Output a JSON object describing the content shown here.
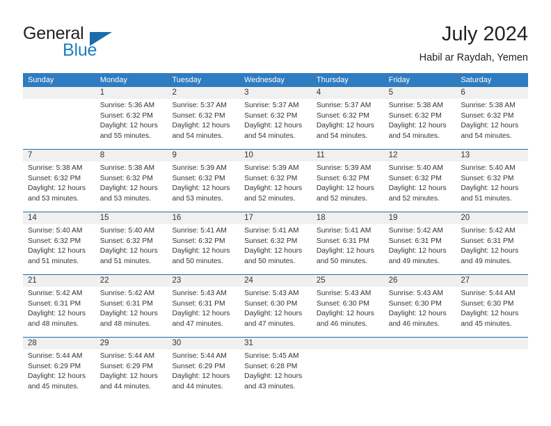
{
  "brand": {
    "word1": "General",
    "word2": "Blue",
    "logo_icon": "blue-triangle-icon",
    "accent_color": "#1f7dc0"
  },
  "header": {
    "title": "July 2024",
    "subtitle": "Habil ar Raydah, Yemen"
  },
  "calendar": {
    "header_bg": "#2f7cc0",
    "band_bg": "#f0f0f0",
    "rule_color": "#1b6cab",
    "weekdays": [
      "Sunday",
      "Monday",
      "Tuesday",
      "Wednesday",
      "Thursday",
      "Friday",
      "Saturday"
    ],
    "weeks": [
      [
        {
          "day": "",
          "sunrise": "",
          "sunset": "",
          "daylight1": "",
          "daylight2": "",
          "empty": true
        },
        {
          "day": "1",
          "sunrise": "Sunrise: 5:36 AM",
          "sunset": "Sunset: 6:32 PM",
          "daylight1": "Daylight: 12 hours",
          "daylight2": "and 55 minutes."
        },
        {
          "day": "2",
          "sunrise": "Sunrise: 5:37 AM",
          "sunset": "Sunset: 6:32 PM",
          "daylight1": "Daylight: 12 hours",
          "daylight2": "and 54 minutes."
        },
        {
          "day": "3",
          "sunrise": "Sunrise: 5:37 AM",
          "sunset": "Sunset: 6:32 PM",
          "daylight1": "Daylight: 12 hours",
          "daylight2": "and 54 minutes."
        },
        {
          "day": "4",
          "sunrise": "Sunrise: 5:37 AM",
          "sunset": "Sunset: 6:32 PM",
          "daylight1": "Daylight: 12 hours",
          "daylight2": "and 54 minutes."
        },
        {
          "day": "5",
          "sunrise": "Sunrise: 5:38 AM",
          "sunset": "Sunset: 6:32 PM",
          "daylight1": "Daylight: 12 hours",
          "daylight2": "and 54 minutes."
        },
        {
          "day": "6",
          "sunrise": "Sunrise: 5:38 AM",
          "sunset": "Sunset: 6:32 PM",
          "daylight1": "Daylight: 12 hours",
          "daylight2": "and 54 minutes."
        }
      ],
      [
        {
          "day": "7",
          "sunrise": "Sunrise: 5:38 AM",
          "sunset": "Sunset: 6:32 PM",
          "daylight1": "Daylight: 12 hours",
          "daylight2": "and 53 minutes."
        },
        {
          "day": "8",
          "sunrise": "Sunrise: 5:38 AM",
          "sunset": "Sunset: 6:32 PM",
          "daylight1": "Daylight: 12 hours",
          "daylight2": "and 53 minutes."
        },
        {
          "day": "9",
          "sunrise": "Sunrise: 5:39 AM",
          "sunset": "Sunset: 6:32 PM",
          "daylight1": "Daylight: 12 hours",
          "daylight2": "and 53 minutes."
        },
        {
          "day": "10",
          "sunrise": "Sunrise: 5:39 AM",
          "sunset": "Sunset: 6:32 PM",
          "daylight1": "Daylight: 12 hours",
          "daylight2": "and 52 minutes."
        },
        {
          "day": "11",
          "sunrise": "Sunrise: 5:39 AM",
          "sunset": "Sunset: 6:32 PM",
          "daylight1": "Daylight: 12 hours",
          "daylight2": "and 52 minutes."
        },
        {
          "day": "12",
          "sunrise": "Sunrise: 5:40 AM",
          "sunset": "Sunset: 6:32 PM",
          "daylight1": "Daylight: 12 hours",
          "daylight2": "and 52 minutes."
        },
        {
          "day": "13",
          "sunrise": "Sunrise: 5:40 AM",
          "sunset": "Sunset: 6:32 PM",
          "daylight1": "Daylight: 12 hours",
          "daylight2": "and 51 minutes."
        }
      ],
      [
        {
          "day": "14",
          "sunrise": "Sunrise: 5:40 AM",
          "sunset": "Sunset: 6:32 PM",
          "daylight1": "Daylight: 12 hours",
          "daylight2": "and 51 minutes."
        },
        {
          "day": "15",
          "sunrise": "Sunrise: 5:40 AM",
          "sunset": "Sunset: 6:32 PM",
          "daylight1": "Daylight: 12 hours",
          "daylight2": "and 51 minutes."
        },
        {
          "day": "16",
          "sunrise": "Sunrise: 5:41 AM",
          "sunset": "Sunset: 6:32 PM",
          "daylight1": "Daylight: 12 hours",
          "daylight2": "and 50 minutes."
        },
        {
          "day": "17",
          "sunrise": "Sunrise: 5:41 AM",
          "sunset": "Sunset: 6:32 PM",
          "daylight1": "Daylight: 12 hours",
          "daylight2": "and 50 minutes."
        },
        {
          "day": "18",
          "sunrise": "Sunrise: 5:41 AM",
          "sunset": "Sunset: 6:31 PM",
          "daylight1": "Daylight: 12 hours",
          "daylight2": "and 50 minutes."
        },
        {
          "day": "19",
          "sunrise": "Sunrise: 5:42 AM",
          "sunset": "Sunset: 6:31 PM",
          "daylight1": "Daylight: 12 hours",
          "daylight2": "and 49 minutes."
        },
        {
          "day": "20",
          "sunrise": "Sunrise: 5:42 AM",
          "sunset": "Sunset: 6:31 PM",
          "daylight1": "Daylight: 12 hours",
          "daylight2": "and 49 minutes."
        }
      ],
      [
        {
          "day": "21",
          "sunrise": "Sunrise: 5:42 AM",
          "sunset": "Sunset: 6:31 PM",
          "daylight1": "Daylight: 12 hours",
          "daylight2": "and 48 minutes."
        },
        {
          "day": "22",
          "sunrise": "Sunrise: 5:42 AM",
          "sunset": "Sunset: 6:31 PM",
          "daylight1": "Daylight: 12 hours",
          "daylight2": "and 48 minutes."
        },
        {
          "day": "23",
          "sunrise": "Sunrise: 5:43 AM",
          "sunset": "Sunset: 6:31 PM",
          "daylight1": "Daylight: 12 hours",
          "daylight2": "and 47 minutes."
        },
        {
          "day": "24",
          "sunrise": "Sunrise: 5:43 AM",
          "sunset": "Sunset: 6:30 PM",
          "daylight1": "Daylight: 12 hours",
          "daylight2": "and 47 minutes."
        },
        {
          "day": "25",
          "sunrise": "Sunrise: 5:43 AM",
          "sunset": "Sunset: 6:30 PM",
          "daylight1": "Daylight: 12 hours",
          "daylight2": "and 46 minutes."
        },
        {
          "day": "26",
          "sunrise": "Sunrise: 5:43 AM",
          "sunset": "Sunset: 6:30 PM",
          "daylight1": "Daylight: 12 hours",
          "daylight2": "and 46 minutes."
        },
        {
          "day": "27",
          "sunrise": "Sunrise: 5:44 AM",
          "sunset": "Sunset: 6:30 PM",
          "daylight1": "Daylight: 12 hours",
          "daylight2": "and 45 minutes."
        }
      ],
      [
        {
          "day": "28",
          "sunrise": "Sunrise: 5:44 AM",
          "sunset": "Sunset: 6:29 PM",
          "daylight1": "Daylight: 12 hours",
          "daylight2": "and 45 minutes."
        },
        {
          "day": "29",
          "sunrise": "Sunrise: 5:44 AM",
          "sunset": "Sunset: 6:29 PM",
          "daylight1": "Daylight: 12 hours",
          "daylight2": "and 44 minutes."
        },
        {
          "day": "30",
          "sunrise": "Sunrise: 5:44 AM",
          "sunset": "Sunset: 6:29 PM",
          "daylight1": "Daylight: 12 hours",
          "daylight2": "and 44 minutes."
        },
        {
          "day": "31",
          "sunrise": "Sunrise: 5:45 AM",
          "sunset": "Sunset: 6:28 PM",
          "daylight1": "Daylight: 12 hours",
          "daylight2": "and 43 minutes."
        },
        {
          "day": "",
          "sunrise": "",
          "sunset": "",
          "daylight1": "",
          "daylight2": "",
          "empty": true
        },
        {
          "day": "",
          "sunrise": "",
          "sunset": "",
          "daylight1": "",
          "daylight2": "",
          "empty": true
        },
        {
          "day": "",
          "sunrise": "",
          "sunset": "",
          "daylight1": "",
          "daylight2": "",
          "empty": true
        }
      ]
    ]
  }
}
